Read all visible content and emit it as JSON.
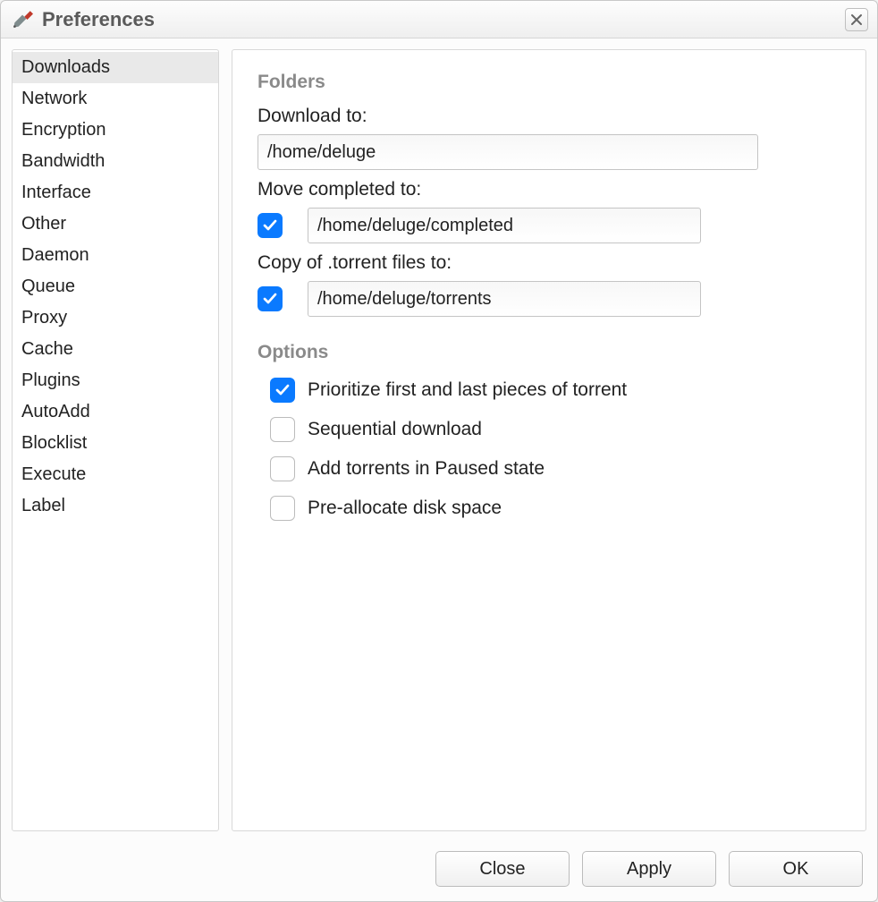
{
  "window": {
    "title": "Preferences"
  },
  "sidebar": {
    "items": [
      {
        "label": "Downloads",
        "selected": true
      },
      {
        "label": "Network"
      },
      {
        "label": "Encryption"
      },
      {
        "label": "Bandwidth"
      },
      {
        "label": "Interface"
      },
      {
        "label": "Other"
      },
      {
        "label": "Daemon"
      },
      {
        "label": "Queue"
      },
      {
        "label": "Proxy"
      },
      {
        "label": "Cache"
      },
      {
        "label": "Plugins"
      },
      {
        "label": "AutoAdd"
      },
      {
        "label": "Blocklist"
      },
      {
        "label": "Execute"
      },
      {
        "label": "Label"
      }
    ]
  },
  "sections": {
    "folders": {
      "title": "Folders",
      "download_to_label": "Download to:",
      "download_to_value": "/home/deluge",
      "move_completed_label": "Move completed to:",
      "move_completed_checked": true,
      "move_completed_value": "/home/deluge/completed",
      "copy_torrent_label": "Copy of .torrent files to:",
      "copy_torrent_checked": true,
      "copy_torrent_value": "/home/deluge/torrents"
    },
    "options": {
      "title": "Options",
      "items": [
        {
          "label": "Prioritize first and last pieces of torrent",
          "checked": true
        },
        {
          "label": "Sequential download",
          "checked": false
        },
        {
          "label": "Add torrents in Paused state",
          "checked": false
        },
        {
          "label": "Pre-allocate disk space",
          "checked": false
        }
      ]
    }
  },
  "footer": {
    "close": "Close",
    "apply": "Apply",
    "ok": "OK"
  }
}
